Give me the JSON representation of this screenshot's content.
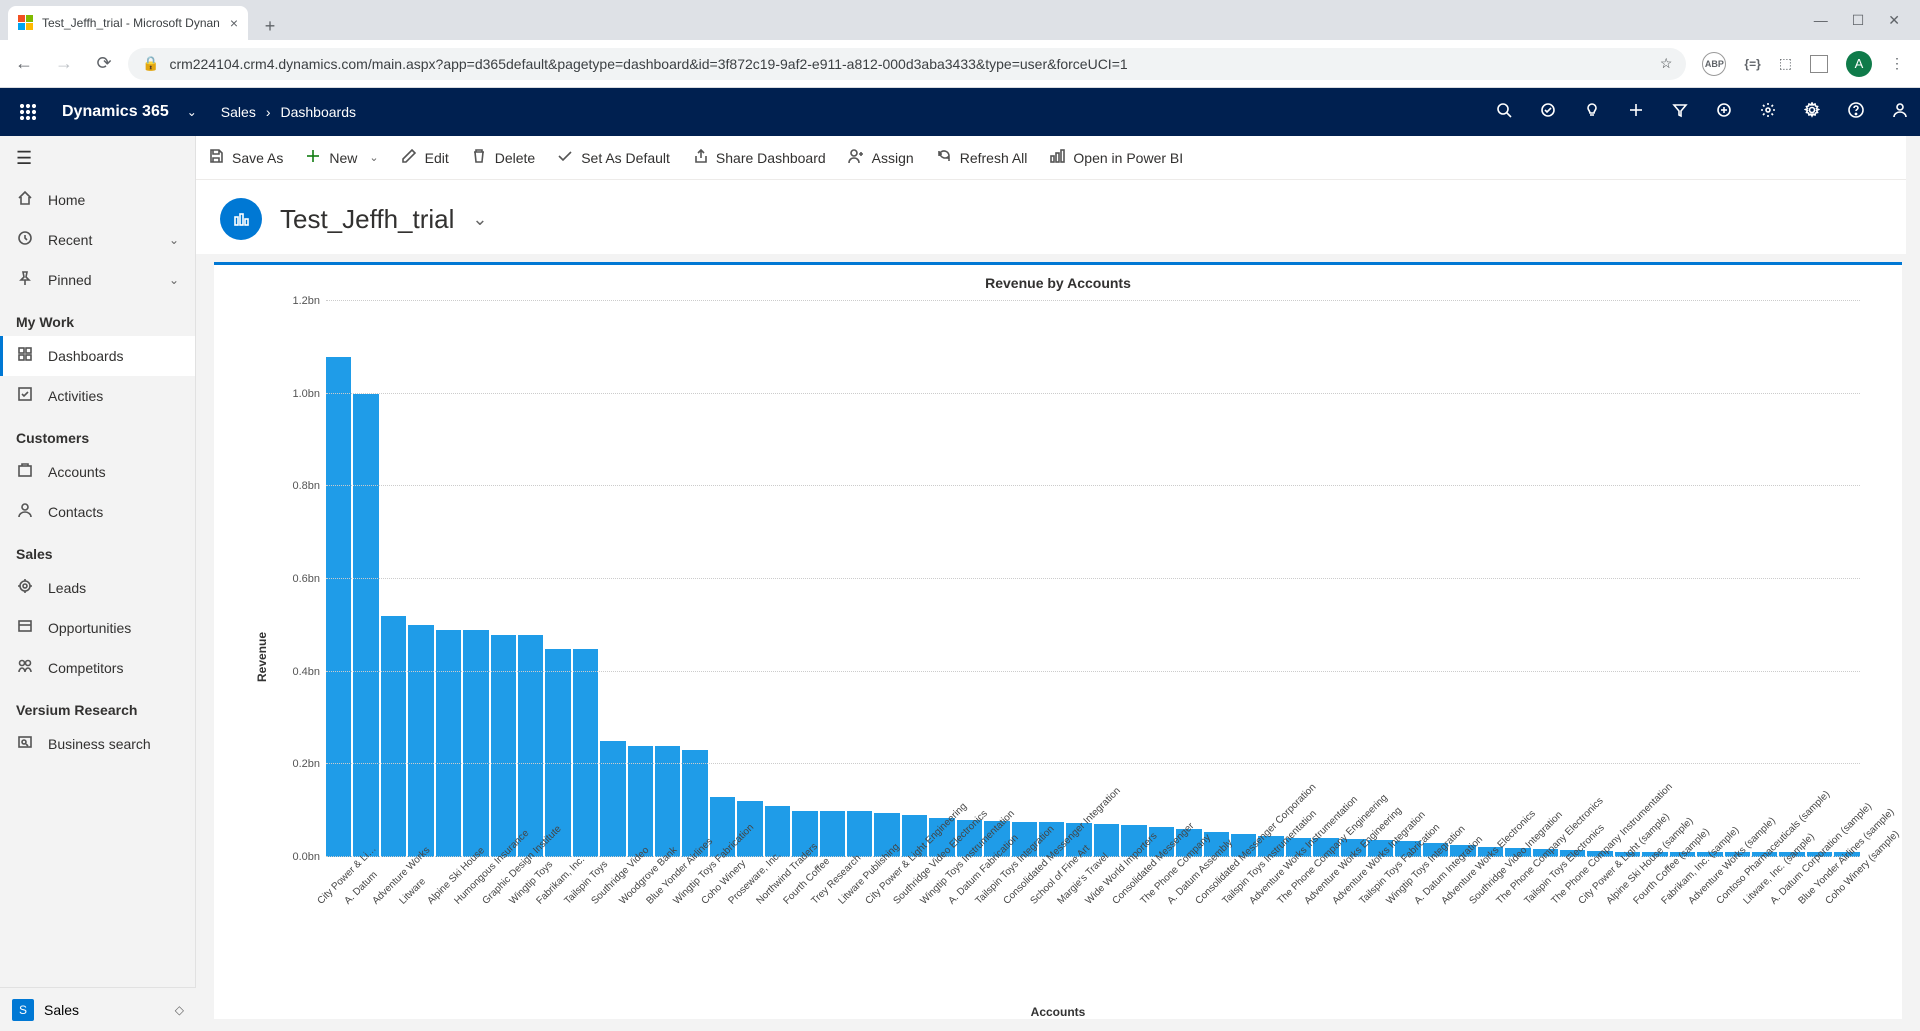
{
  "browser": {
    "tab_title": "Test_Jeffh_trial - Microsoft Dynan",
    "url": "crm224104.crm4.dynamics.com/main.aspx?app=d365default&pagetype=dashboard&id=3f872c19-9af2-e911-a812-000d3aba3433&type=user&forceUCI=1",
    "avatar_initial": "A",
    "ext_labels": {
      "abp": "ABP",
      "braces": "{=}"
    }
  },
  "suite": {
    "title": "Dynamics 365",
    "breadcrumb": [
      "Sales",
      "Dashboards"
    ]
  },
  "sidebar": {
    "top": [
      {
        "icon": "home",
        "label": "Home"
      },
      {
        "icon": "recent",
        "label": "Recent",
        "chev": true
      },
      {
        "icon": "pin",
        "label": "Pinned",
        "chev": true
      }
    ],
    "sections": [
      {
        "title": "My Work",
        "items": [
          {
            "icon": "dash",
            "label": "Dashboards",
            "active": true
          },
          {
            "icon": "activity",
            "label": "Activities"
          }
        ]
      },
      {
        "title": "Customers",
        "items": [
          {
            "icon": "account",
            "label": "Accounts"
          },
          {
            "icon": "contact",
            "label": "Contacts"
          }
        ]
      },
      {
        "title": "Sales",
        "items": [
          {
            "icon": "lead",
            "label": "Leads"
          },
          {
            "icon": "opp",
            "label": "Opportunities"
          },
          {
            "icon": "comp",
            "label": "Competitors"
          }
        ]
      },
      {
        "title": "Versium Research",
        "items": [
          {
            "icon": "search",
            "label": "Business search"
          }
        ]
      }
    ],
    "area": {
      "badge": "S",
      "label": "Sales"
    }
  },
  "commands": [
    {
      "icon": "save",
      "label": "Save As"
    },
    {
      "icon": "plus",
      "label": "New",
      "chev": true
    },
    {
      "icon": "edit",
      "label": "Edit"
    },
    {
      "icon": "delete",
      "label": "Delete"
    },
    {
      "icon": "check",
      "label": "Set As Default"
    },
    {
      "icon": "share",
      "label": "Share Dashboard"
    },
    {
      "icon": "assign",
      "label": "Assign"
    },
    {
      "icon": "refresh",
      "label": "Refresh All"
    },
    {
      "icon": "pbi",
      "label": "Open in Power BI"
    }
  ],
  "page": {
    "title": "Test_Jeffh_trial"
  },
  "chart_data": {
    "type": "bar",
    "title": "Revenue by Accounts",
    "xlabel": "Accounts",
    "ylabel": "Revenue",
    "ylim": [
      0,
      1.2
    ],
    "y_ticks": [
      "0.0bn",
      "0.2bn",
      "0.4bn",
      "0.6bn",
      "0.8bn",
      "1.0bn",
      "1.2bn"
    ],
    "unit": "bn",
    "categories": [
      "City Power & Li…",
      "A. Datum",
      "Adventure Works",
      "Litware",
      "Alpine Ski House",
      "Humongous Insurance",
      "Graphic Design Institute",
      "Wingtip Toys",
      "Fabrikam, Inc.",
      "Tailspin Toys",
      "Southridge Video",
      "Woodgrove Bank",
      "Blue Yonder Airlines",
      "Wingtip Toys Fabrication",
      "Coho Winery",
      "Proseware, Inc.",
      "Northwind Traders",
      "Fourth Coffee",
      "Trey Research",
      "Litware Publishing",
      "City Power & Light Engineering",
      "Southridge Video Electronics",
      "Wingtip Toys Instrumentation",
      "A. Datum Fabrication",
      "Tailspin Toys Integration",
      "Consolidated Messenger Integration",
      "School of Fine Art",
      "Margie's Travel",
      "Wide World Importers",
      "Consolidated Messenger",
      "The Phone Company",
      "A. Datum Assembly",
      "Consolidated Messenger Corporation",
      "Tailspin Toys Instrumentation",
      "Adventure Works Instrumentation",
      "The Phone Company Engineering",
      "Adventure Works Engineering",
      "Adventure Works Integration",
      "Tailspin Toys Fabrication",
      "Wingtip Toys Integration",
      "A. Datum Integration",
      "Adventure Works Electronics",
      "Southridge Video Integration",
      "The Phone Company Electronics",
      "Tailspin Toys Electronics",
      "The Phone Company Instrumentation",
      "City Power & Light (sample)",
      "Alpine Ski House (sample)",
      "Fourth Coffee (sample)",
      "Fabrikam, Inc. (sample)",
      "Adventure Works (sample)",
      "Contoso Pharmaceuticals (sample)",
      "Litware, Inc. (sample)",
      "A. Datum Corporation (sample)",
      "Blue Yonder Airlines (sample)",
      "Coho Winery (sample)"
    ],
    "values": [
      1.08,
      1.0,
      0.52,
      0.5,
      0.49,
      0.49,
      0.48,
      0.48,
      0.45,
      0.45,
      0.25,
      0.24,
      0.24,
      0.23,
      0.13,
      0.12,
      0.11,
      0.1,
      0.1,
      0.1,
      0.095,
      0.09,
      0.085,
      0.08,
      0.078,
      0.076,
      0.075,
      0.074,
      0.072,
      0.07,
      0.065,
      0.06,
      0.055,
      0.05,
      0.045,
      0.042,
      0.04,
      0.038,
      0.036,
      0.034,
      0.03,
      0.025,
      0.022,
      0.02,
      0.018,
      0.015,
      0.012,
      0.01,
      0.01,
      0.01,
      0.01,
      0.01,
      0.01,
      0.01,
      0.01,
      0.01
    ]
  }
}
